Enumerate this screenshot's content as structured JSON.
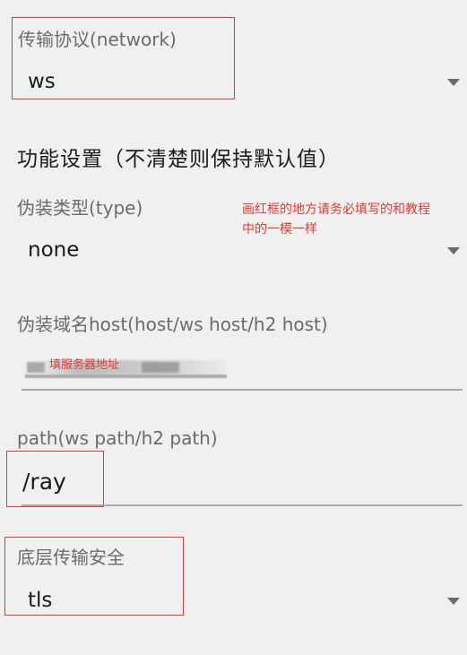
{
  "network": {
    "label": "传输协议(network)",
    "value": "ws",
    "icon": "chevron-down-icon"
  },
  "features": {
    "title": "功能设置（不清楚则保持默认值）"
  },
  "type": {
    "label": "伪装类型(type)",
    "value": "none",
    "icon": "chevron-down-icon"
  },
  "annotation": {
    "text_line1": "画红框的地方请务必填写的和教程",
    "text_line2": "中的一模一样",
    "color": "#e53935"
  },
  "host": {
    "label": "伪装域名host(host/ws host/h2 host)",
    "note": "填服务器地址"
  },
  "path": {
    "label": "path(ws path/h2 path)",
    "value": "/ray"
  },
  "security": {
    "label": "底层传输安全",
    "value": "tls",
    "icon": "chevron-down-icon"
  },
  "colors": {
    "background": "#f0f0f0",
    "highlight": "#e53935",
    "underline": "#a9a9a9"
  }
}
